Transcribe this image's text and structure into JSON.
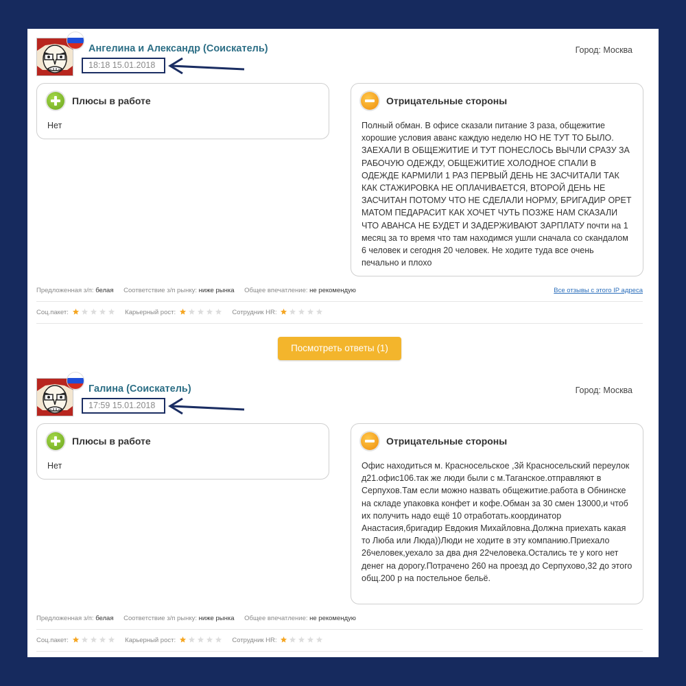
{
  "colors": {
    "frame": "#162a5e",
    "author": "#2c6e85",
    "button": "#f3b52c",
    "star_on": "#f5a623",
    "star_off": "#dddddd",
    "link": "#2a6ebb"
  },
  "reviews": [
    {
      "author": "Ангелина и Александр (Соискатель)",
      "datetime": "18:18 15.01.2018",
      "city": "Город: Москва",
      "pros_title": "Плюсы в работе",
      "pros_text": "Нет",
      "cons_title": "Отрицательные стороны",
      "cons_text": "Полный обман. В офисе сказали питание 3 раза, общежитие хорошие условия аванс каждую неделю НО НЕ ТУТ ТО БЫЛО. ЗАЕХАЛИ В ОБЩЕЖИТИЕ И ТУТ ПОНЕСЛОСЬ ВЫЧЛИ СРАЗУ ЗА РАБОЧУЮ ОДЕЖДУ, ОБЩЕЖИТИЕ ХОЛОДНОЕ СПАЛИ В ОДЕЖДЕ КАРМИЛИ 1 РАЗ ПЕРВЫЙ ДЕНЬ НЕ ЗАСЧИТАЛИ ТАК КАК СТАЖИРОВКА НЕ ОПЛАЧИВАЕТСЯ, ВТОРОЙ ДЕНЬ НЕ ЗАСЧИТАН ПОТОМУ ЧТО НЕ СДЕЛАЛИ НОРМУ, БРИГАДИР ОРЕТ МАТОМ ПЕДАРАСИТ КАК ХОЧЕТ ЧУТЬ ПОЗЖЕ НАМ СКАЗАЛИ ЧТО АВАНСА НЕ БУДЕТ И ЗАДЕРЖИВАЮТ ЗАРПЛАТУ почти на 1 месяц за то время что там находимся ушли сначала со скандалом 6 человек и сегодня 20 человек. Не ходите туда все очень печально и плохо",
      "salary_label": "Предложенная з/п:",
      "salary_value": "белая",
      "market_label": "Соответствие з/п рынку:",
      "market_value": "ниже рынка",
      "impression_label": "Общее впечатление:",
      "impression_value": "не рекомендую",
      "ip_link": "Все отзывы с этого IP адреса",
      "social_label": "Соц.пакет:",
      "social_rating": 1,
      "career_label": "Карьерный рост:",
      "career_rating": 1,
      "hr_label": "Сотрудник HR:",
      "hr_rating": 1
    },
    {
      "author": "Галина (Соискатель)",
      "datetime": "17:59 15.01.2018",
      "city": "Город: Москва",
      "pros_title": "Плюсы в работе",
      "pros_text": "Нет",
      "cons_title": "Отрицательные стороны",
      "cons_text": "Офис находиться м. Красносельское ,3й Красносельский переулок д21.офис106.так же люди были с м.Таганское.отправляют в Серпухов.Там если можно назвать общежитие.работа в Обнинске на складе упаковка конфет и кофе.Обман за 30 смен 13000,и чтоб их получить надо ещё 10 отработать.координатор Анастасия,бригадир Евдокия Михайловна.Должна приехать какая то Люба или Люда))Люди не ходите в эту компанию.Приехало 26человек,уехало за два дня 22человека.Остались те у кого нет денег на дорогу.Потрачено 260 на проезд до Серпухово,32 до этого общ.200 р на постельное бельё.",
      "salary_label": "Предложенная з/п:",
      "salary_value": "белая",
      "market_label": "Соответствие з/п рынку:",
      "market_value": "ниже рынка",
      "impression_label": "Общее впечатление:",
      "impression_value": "не рекомендую",
      "social_label": "Соц.пакет:",
      "social_rating": 1,
      "career_label": "Карьерный рост:",
      "career_rating": 1,
      "hr_label": "Сотрудник HR:",
      "hr_rating": 1
    }
  ],
  "answers_button": "Посмотреть ответы (1)"
}
